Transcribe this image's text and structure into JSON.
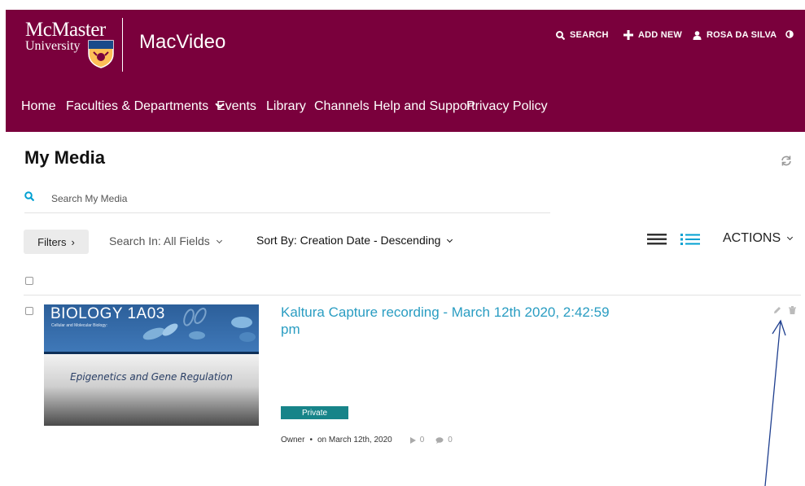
{
  "header": {
    "logo_line1": "McMaster",
    "logo_line2": "University",
    "app_name": "MacVideo",
    "search_label": "SEARCH",
    "add_new_label": "ADD NEW",
    "user_name": "ROSA DA SILVA",
    "brand_color": "#7a003c"
  },
  "nav": {
    "items": [
      "Home",
      "Faculties & Departments",
      "Events",
      "Library",
      "Channels",
      "Help and Support",
      "Privacy Policy"
    ]
  },
  "page": {
    "title": "My Media"
  },
  "search": {
    "placeholder": "Search My Media"
  },
  "toolbar": {
    "filters_label": "Filters",
    "search_in_label": "Search In: All Fields",
    "sort_label": "Sort By: Creation Date - Descending",
    "actions_label": "ACTIONS"
  },
  "media": [
    {
      "thumb_course": "BIOLOGY 1A03",
      "thumb_subtitle": "Cellular and Molecular Biology:",
      "thumb_topic": "Epigenetics and Gene Regulation",
      "title": "Kaltura Capture recording - March 12th 2020, 2:42:59 pm",
      "status": "Private",
      "owner": "Owner",
      "date": "on March 12th, 2020",
      "plays": "0",
      "comments": "0"
    }
  ],
  "icons": {
    "search": "search-icon",
    "add": "plus-icon",
    "user": "user-icon",
    "contrast": "contrast-icon",
    "refresh": "refresh-icon",
    "list_view": "list-view-icon",
    "details_view": "details-view-icon",
    "edit": "pencil-icon",
    "delete": "trash-icon"
  },
  "colors": {
    "link": "#2a9dc2",
    "badge": "#178489",
    "accent": "#00a0d2"
  }
}
